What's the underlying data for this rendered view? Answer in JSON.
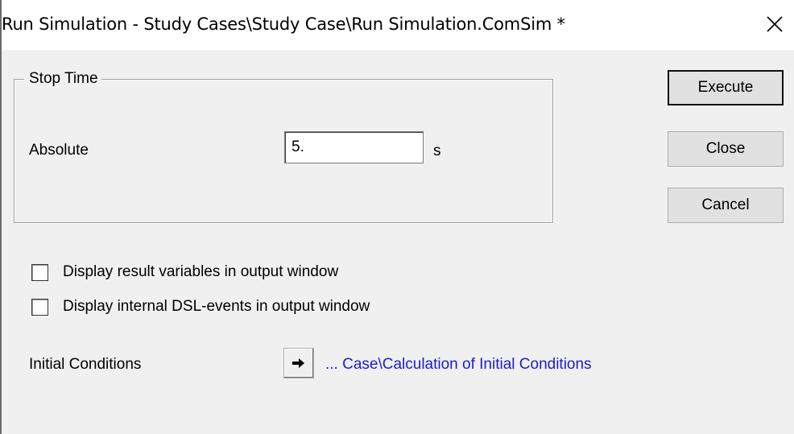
{
  "window": {
    "title": "Run Simulation - Study Cases\\Study Case\\Run Simulation.ComSim *",
    "close_icon": "close-x-icon"
  },
  "stop_time": {
    "group_label": "Stop Time",
    "absolute_label": "Absolute",
    "absolute_value": "5.",
    "unit": "s"
  },
  "buttons": {
    "execute": "Execute",
    "close": "Close",
    "cancel": "Cancel"
  },
  "options": [
    {
      "label": "Display result variables in output window",
      "checked": false
    },
    {
      "label": "Display internal DSL-events in output window",
      "checked": false
    }
  ],
  "initial_conditions": {
    "label": "Initial Conditions",
    "arrow_icon": "right-arrow-icon",
    "link_text": "... Case\\Calculation of Initial Conditions",
    "link_color": "#1a1ad6"
  }
}
